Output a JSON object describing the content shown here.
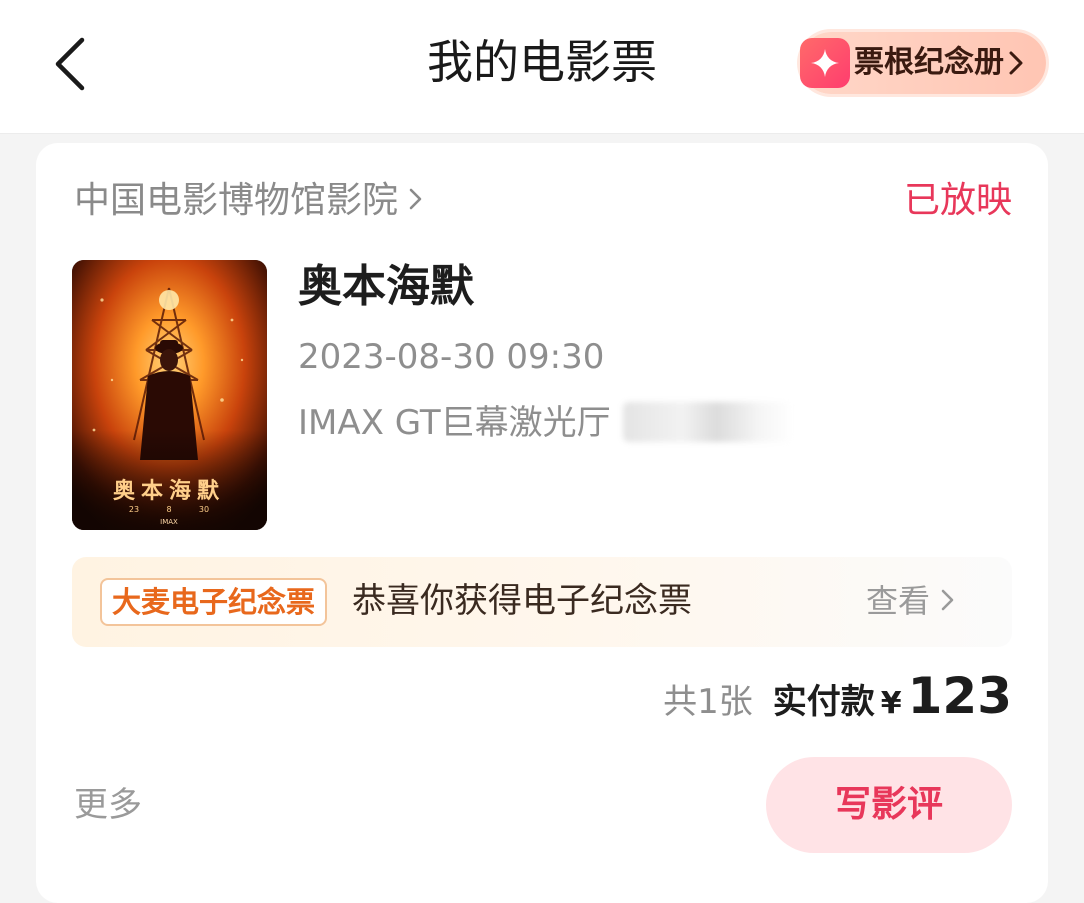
{
  "header": {
    "title": "我的电影票",
    "stub_album_label": "票根纪念册"
  },
  "order": {
    "cinema": "中国电影博物馆影院",
    "status": "已放映",
    "movie_title": "奥本海默",
    "showtime": "2023-08-30 09:30",
    "hall": "IMAX GT巨幕激光厅",
    "poster": {
      "title_text": "奥本海默",
      "dates": [
        "23",
        "8",
        "30"
      ],
      "format_text": "IMAX"
    },
    "souvenir": {
      "tag": "大麦电子纪念票",
      "message": "恭喜你获得电子纪念票",
      "view_label": "查看"
    },
    "total": {
      "count": "共1张",
      "paid_label": "实付款",
      "currency": "¥",
      "amount": "123"
    },
    "more_label": "更多",
    "review_label": "写影评"
  },
  "colors": {
    "accent_red": "#e8375a",
    "review_bg": "#ffe3e6",
    "souvenir_orange": "#e8681c"
  }
}
